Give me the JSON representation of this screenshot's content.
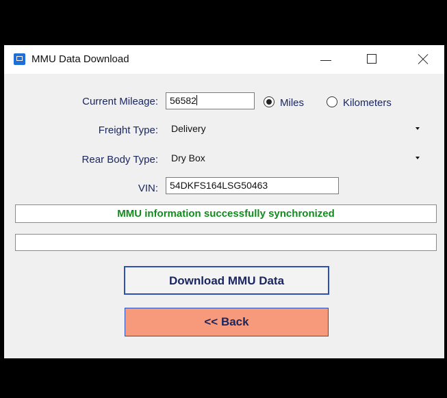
{
  "window": {
    "title": "MMU Data Download"
  },
  "form": {
    "mileage_label": "Current Mileage:",
    "mileage_value": "56582",
    "unit_options": [
      "Miles",
      "Kilometers"
    ],
    "unit_selected": "Miles",
    "freight_label": "Freight Type:",
    "freight_value": "Delivery",
    "rear_body_label": "Rear Body Type:",
    "rear_body_value": "Dry Box",
    "vin_label": "VIN:",
    "vin_value": "54DKFS164LSG50463"
  },
  "status": {
    "message": "MMU information successfully synchronized",
    "message_color": "#118a1e",
    "secondary": ""
  },
  "buttons": {
    "download": "Download MMU Data",
    "back": "<< Back",
    "back_color": "#f79a7b"
  },
  "icons": [
    "app-icon",
    "minimize-icon",
    "maximize-icon",
    "close-icon",
    "dropdown-arrow-icon"
  ]
}
